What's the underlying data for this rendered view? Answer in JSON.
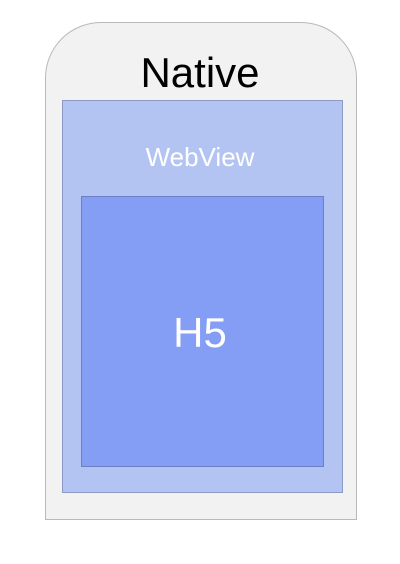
{
  "diagram": {
    "native": {
      "label": "Native",
      "fill_color": "#f2f2f2",
      "border_color": "#b9b9b9",
      "text_color": "#000000"
    },
    "webview": {
      "label": "WebView",
      "fill_color": "#b4c4f2",
      "border_color": "#8d9ac4",
      "text_color": "#ffffff"
    },
    "h5": {
      "label": "H5",
      "fill_color": "#849df5",
      "border_color": "#6c7fc1",
      "text_color": "#ffffff"
    }
  }
}
